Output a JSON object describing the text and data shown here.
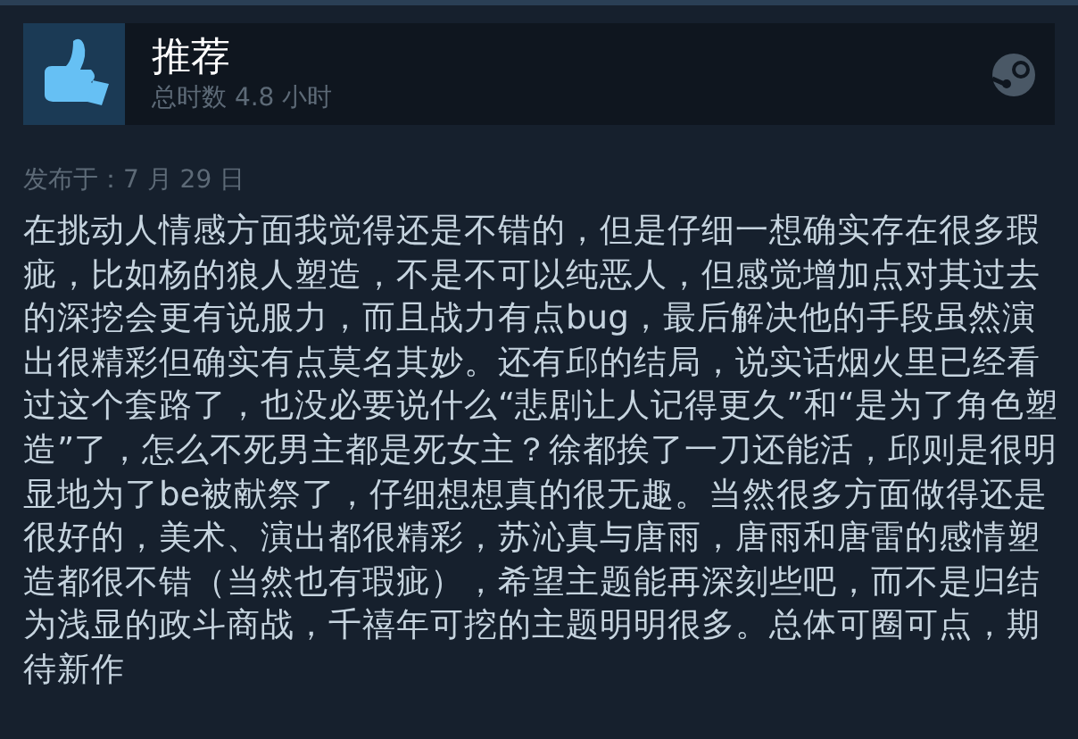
{
  "review": {
    "verdict": "推荐",
    "recommended": true,
    "playtime": "总时数 4.8 小时",
    "posted": "发布于：7 月 29 日",
    "body": "在挑动人情感方面我觉得还是不错的，但是仔细一想确实存在很多瑕疵，比如杨的狼人塑造，不是不可以纯恶人，但感觉增加点对其过去的深挖会更有说服力，而且战力有点bug，最后解决他的手段虽然演出很精彩但确实有点莫名其妙。还有邱的结局，说实话烟火里已经看过这个套路了，也没必要说什么“悲剧让人记得更久”和“是为了角色塑造”了，怎么不死男主都是死女主？徐都挨了一刀还能活，邱则是很明显地为了be被献祭了，仔细想想真的很无趣。当然很多方面做得还是很好的，美术、演出都很精彩，苏沁真与唐雨，唐雨和唐雷的感情塑造都很不错（当然也有瑕疵），希望主题能再深刻些吧，而不是归结为浅显的政斗商战，千禧年可挖的主题明明很多。总体可圈可点，期待新作"
  }
}
